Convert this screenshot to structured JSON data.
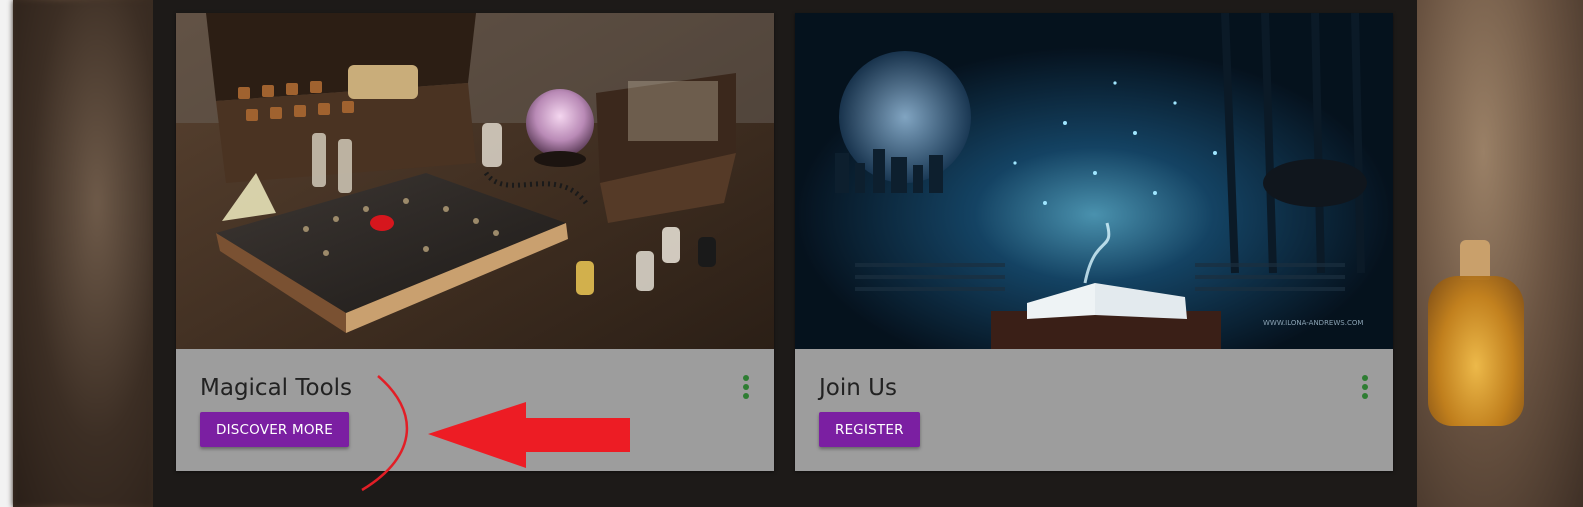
{
  "cards": [
    {
      "title": "Magical Tools",
      "button_label": "DISCOVER MORE",
      "image": "magical-tools-photo",
      "menu_icon": "more-vert-icon"
    },
    {
      "title": "Join Us",
      "button_label": "REGISTER",
      "image": "open-book-forest-photo",
      "menu_icon": "more-vert-icon",
      "image_caption": "WWW.ILONA-ANDREWS.COM"
    }
  ],
  "annotation": {
    "arrow_color": "#ed1c24",
    "stroke_color": "#e21e26"
  },
  "colors": {
    "button": "#7b1fa2",
    "menu_dots": "#2e7d32",
    "card_bg": "#9d9d9d"
  }
}
